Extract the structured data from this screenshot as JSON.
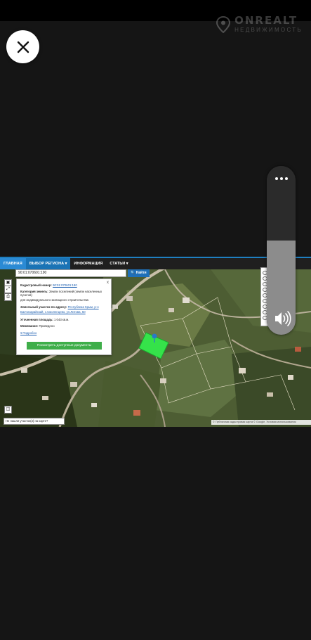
{
  "watermark": {
    "brand": "ONREALT",
    "subtitle": "НЕДВИЖИМОСТЬ"
  },
  "screen": {
    "nav": [
      {
        "label": "ГЛАВНАЯ",
        "state": "active"
      },
      {
        "label": "ВЫБОР РЕГИОНА ▾",
        "state": "selected"
      },
      {
        "label": "ИНФОРМАЦИЯ",
        "state": "normal"
      },
      {
        "label": "СТАТЬИ ▾",
        "state": "normal"
      }
    ],
    "search": {
      "value": "90:01:070601:190",
      "button": "Найти"
    },
    "card": {
      "cadastral_label": "Кадастровый номер:",
      "cadastral_value": "90:01:070601:190",
      "category_label": "Категория земель:",
      "category_value": "Земли поселений (земли населенных пунктов)",
      "category_value2": "для индивидуального жилищного строительства",
      "address_label": "Земельный участок по адресу:",
      "address_value": "Республика Крым, р-н",
      "address_value2": "Бахчисарайский, с.Смоленцево, ул.Литова, 50",
      "area_label": "Уточненная площадь:",
      "area_value": "1 043 кв.м.",
      "boundary_label": "Межевание:",
      "boundary_value": "Проведено",
      "more": "▾ Подробно",
      "button": "Посмотреть доступные документы",
      "close": "x"
    },
    "status_hint": "Не нашли участок(и) на карте?",
    "copyright": "© Публичная кадастровая карта © Google, Условия использования"
  },
  "icons": {
    "close": "close-icon",
    "more": "more-dots-icon",
    "volume": "volume-icon"
  },
  "colors": {
    "accent": "#2b8ad4",
    "button_green": "#3fae4a",
    "parcel": "#35e24a"
  }
}
